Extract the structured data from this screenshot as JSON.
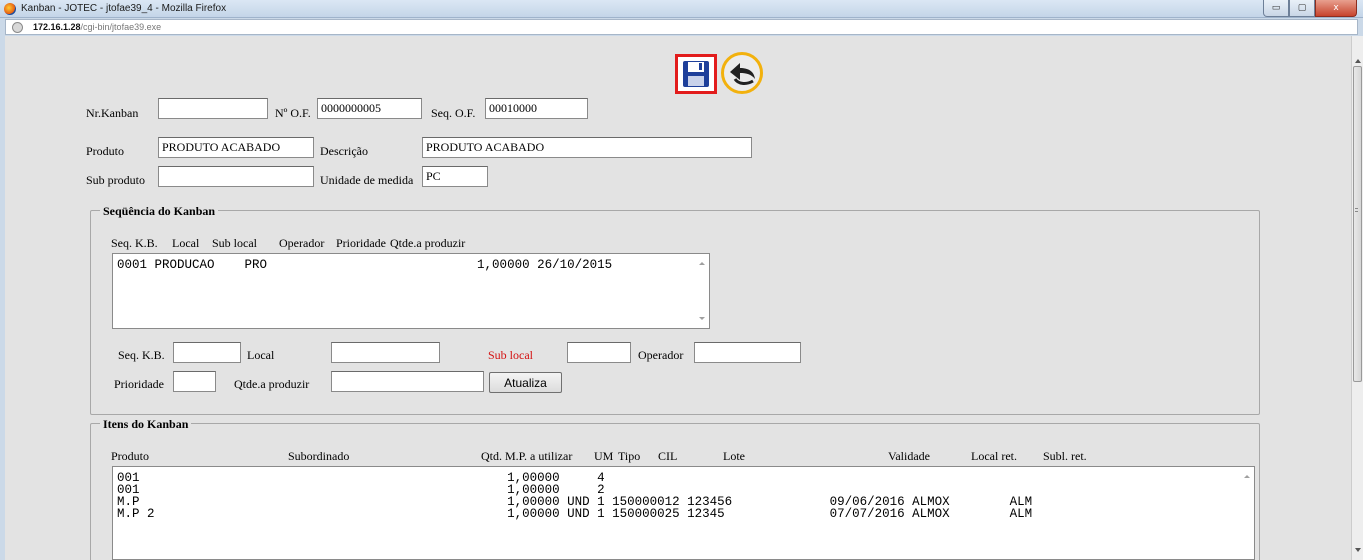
{
  "window": {
    "title": "Kanban - JOTEC - jtofae39_4 - Mozilla Firefox",
    "url_host": "172.16.1.28",
    "url_path": "/cgi-bin/jtofae39.exe",
    "controls": {
      "minimize": "▭",
      "maximize": "▢",
      "close": "x"
    }
  },
  "toolbar": {
    "save_icon": "floppy-disk-icon",
    "back_icon": "return-arrow-icon"
  },
  "header": {
    "nr_kanban_label": "Nr.Kanban",
    "nr_kanban_value": "",
    "nof_label": "Nº O.F.",
    "nof_value": "0000000005",
    "seq_of_label": "Seq. O.F.",
    "seq_of_value": "00010000",
    "produto_label": "Produto",
    "produto_value": "PRODUTO ACABADO",
    "descricao_label": "Descrição",
    "descricao_value": "PRODUTO ACABADO",
    "subproduto_label": "Sub produto",
    "subproduto_value": "",
    "unidade_label": "Unidade de medida",
    "unidade_value": "PC"
  },
  "sequencia": {
    "legend": "Seqüência do Kanban",
    "columns": "Seq. K.B.  Local     Sub local  Operador  Prioridade  Qtde.a produzir",
    "col_seq": "Seq. K.B.",
    "col_local": "Local",
    "col_sublocal": "Sub local",
    "col_operador": "Operador",
    "col_prioridade": "Prioridade",
    "col_qtde": "Qtde.a produzir",
    "rows": [
      "0001 PRODUCAO    PRO                            1,00000 26/10/2015"
    ],
    "form": {
      "seq_label": "Seq. K.B.",
      "seq_value": "",
      "local_label": "Local",
      "local_value": "",
      "sublocal_label": "Sub local",
      "sublocal_value": "",
      "operador_label": "Operador",
      "operador_value": "",
      "prioridade_label": "Prioridade",
      "prioridade_value": "",
      "qtde_label": "Qtde.a produzir",
      "qtde_value": "",
      "atualiza_label": "Atualiza"
    }
  },
  "itens": {
    "legend": "Itens do Kanban",
    "col_produto": "Produto",
    "col_subordinado": "Subordinado",
    "col_qtd": "Qtd. M.P. a utilizar",
    "col_um": "UM",
    "col_tipo": "Tipo",
    "col_cil": "CIL",
    "col_lote": "Lote",
    "col_validade": "Validade",
    "col_localret": "Local ret.",
    "col_sublret": "Subl. ret.",
    "rows": [
      "001                                                 1,00000     4",
      "001                                                 1,00000     2",
      "M.P                                                 1,00000 UND 1 150000012 123456             09/06/2016 ALMOX        ALM",
      "M.P 2                                               1,00000 UND 1 150000025 12345              07/07/2016 ALMOX        ALM"
    ]
  },
  "colors": {
    "save_border": "#e21c1c",
    "back_border": "#f2b10d",
    "red_label": "#d41010"
  }
}
